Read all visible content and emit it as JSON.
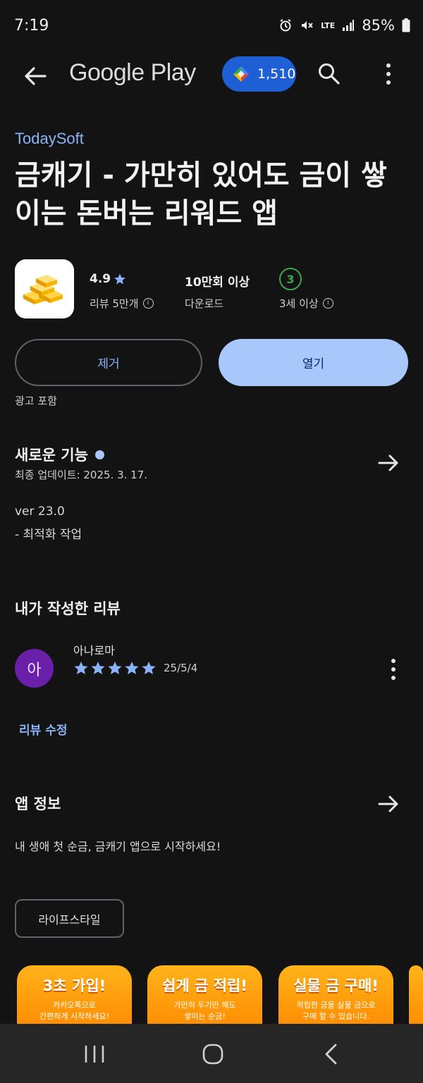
{
  "status": {
    "time": "7:19",
    "network": "LTE",
    "battery": "85%"
  },
  "appbar": {
    "title": "Google Play",
    "points": "1,510"
  },
  "app": {
    "developer": "TodaySoft",
    "title": "금캐기 - 가만히 있어도 금이 쌓이는 돈버는 리워드 앱",
    "rating": "4.9",
    "rating_sub": "리뷰 5만개",
    "downloads": "10만회 이상",
    "downloads_sub": "다운로드",
    "age_badge": "3",
    "age_sub": "3세 이상",
    "remove_label": "제거",
    "open_label": "열기",
    "ads_note": "광고 포함"
  },
  "whats_new": {
    "title": "새로운 기능",
    "date": "최종 업데이트: 2025. 3. 17.",
    "version": "ver 23.0",
    "note": "- 최적화 작업"
  },
  "my_review": {
    "title": "내가 작성한 리뷰",
    "avatar_letter": "아",
    "reviewer": "아나로마",
    "stars": 5,
    "date": "25/5/4",
    "edit_label": "리뷰 수정"
  },
  "about": {
    "title": "앱 정보",
    "description": "내 생애 첫 순금, 금캐기 앱으로 시작하세요!",
    "category_chip": "라이프스타일"
  },
  "screenshots": [
    {
      "headline": "3초 가입!",
      "sub1": "카카오톡으로",
      "sub2": "간편하게 시작하세요!"
    },
    {
      "headline": "쉽게 금 적립!",
      "sub1": "가만히 두기만 해도",
      "sub2": "쌓이는 순금!"
    },
    {
      "headline": "실물 금 구매!",
      "sub1": "적립한 금을 실물 금으로",
      "sub2": "구매 할 수 있습니다."
    }
  ],
  "colors": {
    "accent": "#8ab4f8",
    "open_button": "#a8c7fa",
    "points_pill": "#1f5fd6",
    "age_green": "#3ea54f",
    "avatar": "#6a1fa8"
  }
}
